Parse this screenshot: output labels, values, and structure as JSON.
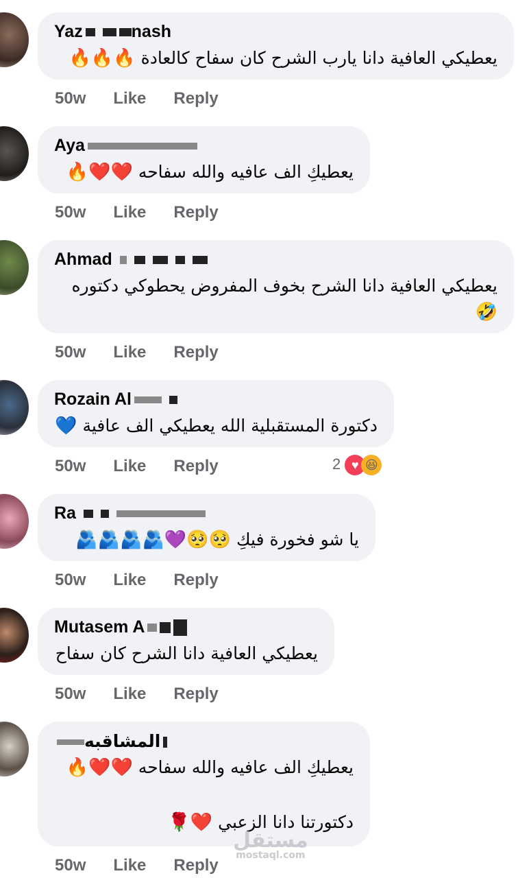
{
  "comments": [
    {
      "name": "Yaz",
      "name_tail": "nash",
      "lines": [
        "يعطيكي العافية  دانا  يارب الشرح كان سفاح كالعادة"
      ],
      "emoji_end": "🔥🔥🔥",
      "time": "50w",
      "like": "Like",
      "reply": "Reply"
    },
    {
      "name": "Aya",
      "lines": [
        "يعطيكِ الف عافيه والله سفاحه"
      ],
      "emoji_end": "❤️❤️🔥",
      "time": "50w",
      "like": "Like",
      "reply": "Reply"
    },
    {
      "name": "Ahmad",
      "lines": [
        "يعطيكي العافية دانا الشرح بخوف المفروض يحطوكي دكتوره"
      ],
      "emoji_line2": "🤣",
      "time": "50w",
      "like": "Like",
      "reply": "Reply"
    },
    {
      "name": "Rozain Al",
      "lines": [
        "دكتورة المستقبلية الله يعطيكي الف عافية"
      ],
      "emoji_end": "💙",
      "time": "50w",
      "like": "Like",
      "reply": "Reply",
      "reaction_count": "2"
    },
    {
      "name": "Ra",
      "lines": [
        "يا شو فخورة فيكِ"
      ],
      "emoji_end": "🥺🥺💜🫂🫂🫂🫂",
      "time": "50w",
      "like": "Like",
      "reply": "Reply"
    },
    {
      "name": "Mutasem A",
      "lines": [
        "يعطيكي العافية دانا الشرح كان سفاح"
      ],
      "time": "50w",
      "like": "Like",
      "reply": "Reply"
    },
    {
      "name": "المشاقبه",
      "lines": [
        "يعطيكِ الف عافيه والله سفاحه",
        "دكتورتنا دانا الزعبي"
      ],
      "emoji_end": "❤️❤️🔥",
      "emoji_end2": "❤️🌹",
      "time": "50w",
      "like": "Like",
      "reply": "Reply"
    }
  ],
  "watermark": {
    "text": "مستقل",
    "sub": "mostaql.com"
  },
  "colors": {
    "bubble": "#f0f2f5",
    "meta": "#65676b",
    "text": "#050505"
  }
}
